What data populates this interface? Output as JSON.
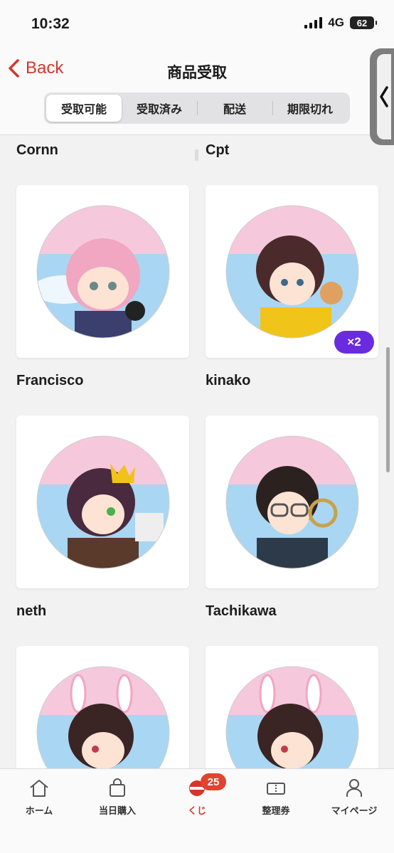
{
  "status_bar": {
    "time": "10:32",
    "network": "4G",
    "battery": "62"
  },
  "nav": {
    "back_label": "Back",
    "title": "商品受取"
  },
  "tabs": [
    {
      "label": "受取可能",
      "active": true
    },
    {
      "label": "受取済み",
      "active": false
    },
    {
      "label": "配送",
      "active": false
    },
    {
      "label": "期限切れ",
      "active": false
    }
  ],
  "items": [
    {
      "name": "Cornn",
      "quantity": null
    },
    {
      "name": "Cpt",
      "quantity": "×2"
    },
    {
      "name": "Francisco",
      "quantity": null
    },
    {
      "name": "kinako",
      "quantity": null
    },
    {
      "name": "neth",
      "quantity": null
    },
    {
      "name": "Tachikawa",
      "quantity": null
    }
  ],
  "tab_bar": {
    "items": [
      {
        "label": "ホーム",
        "icon": "home-icon"
      },
      {
        "label": "当日購入",
        "icon": "shopping-bag-icon"
      },
      {
        "label": "くじ",
        "icon": "lottery-icon",
        "badge": "25",
        "active": true
      },
      {
        "label": "整理券",
        "icon": "ticket-icon"
      },
      {
        "label": "マイページ",
        "icon": "person-icon"
      }
    ]
  },
  "colors": {
    "accent": "#d6352b",
    "badge_purple": "#6a2be0",
    "notif": "#e0432f"
  }
}
